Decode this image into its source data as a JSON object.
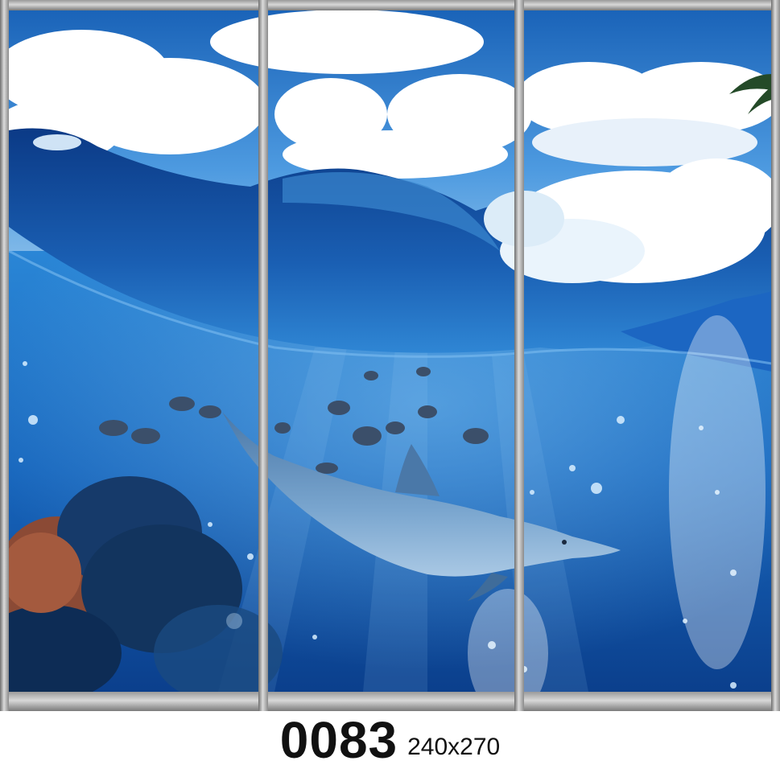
{
  "scene": {
    "description_icon": "underwater-dolphin-wave-image",
    "panels": 3,
    "colors": {
      "sky_top": "#1e6fc4",
      "sky_light": "#5fa7e6",
      "wave_deep": "#0d3e8f",
      "wave_mid": "#1c63b8",
      "water_top": "#1f74c8",
      "water_bottom": "#0a3d8a",
      "cloud": "#ffffff",
      "coral": "#8b4a35",
      "dolphin": "#5f8fbc",
      "frame": "#b5b5b5"
    }
  },
  "caption": {
    "code": "0083",
    "size": "240x270"
  }
}
